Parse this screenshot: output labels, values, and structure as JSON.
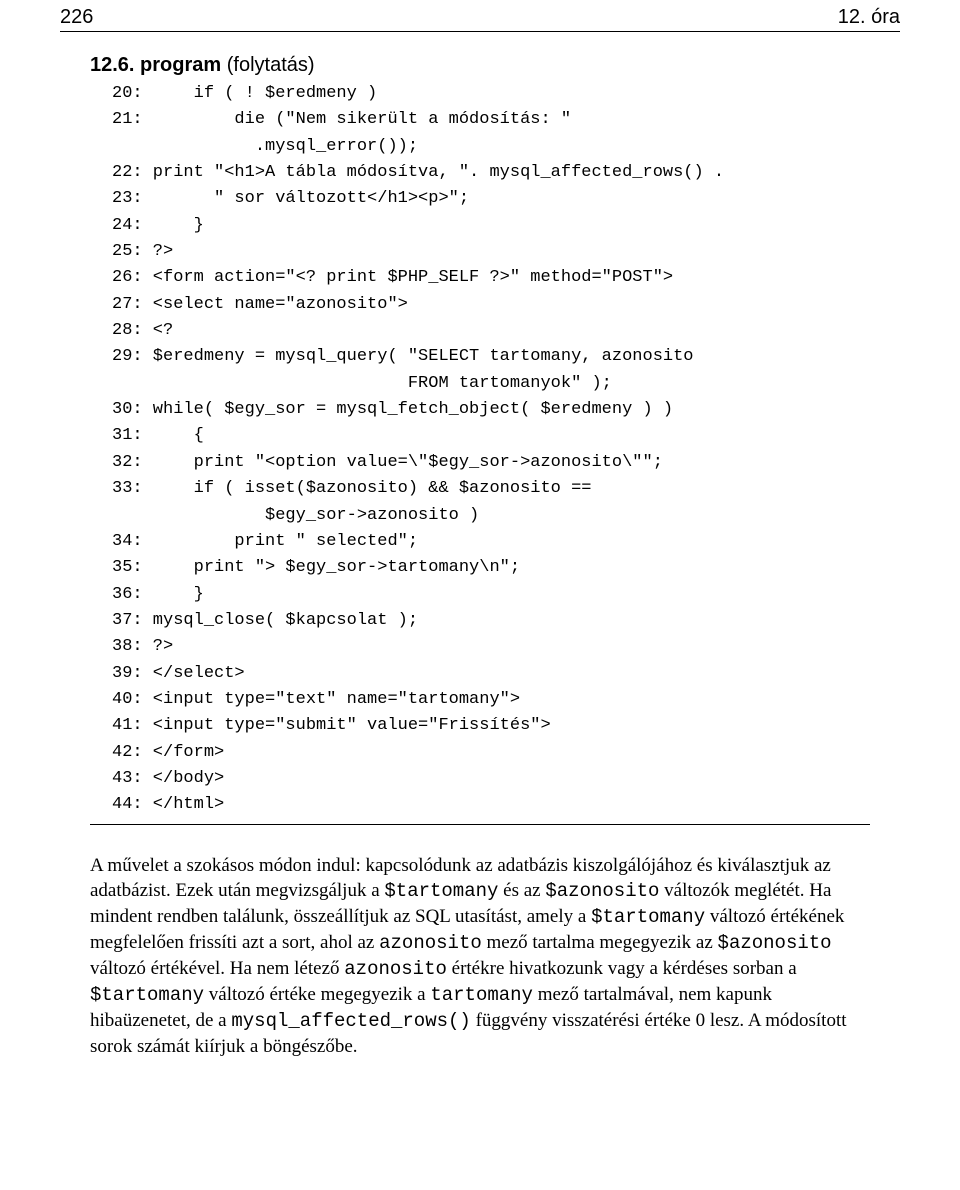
{
  "header": {
    "page_number": "226",
    "chapter": "12. óra"
  },
  "program": {
    "number": "12.6.",
    "label": "program",
    "suffix": "(folytatás)"
  },
  "code": "20:     if ( ! $eredmeny )\n21:         die (\"Nem sikerült a módosítás: \"\n              .mysql_error());\n22: print \"<h1>A tábla módosítva, \". mysql_affected_rows() .\n23:       \" sor változott</h1><p>\";\n24:     }\n25: ?>\n26: <form action=\"<? print $PHP_SELF ?>\" method=\"POST\">\n27: <select name=\"azonosito\">\n28: <?\n29: $eredmeny = mysql_query( \"SELECT tartomany, azonosito\n                             FROM tartomanyok\" );\n30: while( $egy_sor = mysql_fetch_object( $eredmeny ) )\n31:     {\n32:     print \"<option value=\\\"$egy_sor->azonosito\\\"\";\n33:     if ( isset($azonosito) && $azonosito ==\n               $egy_sor->azonosito )\n34:         print \" selected\";\n35:     print \"> $egy_sor->tartomany\\n\";\n36:     }\n37: mysql_close( $kapcsolat );\n38: ?>\n39: </select>\n40: <input type=\"text\" name=\"tartomany\">\n41: <input type=\"submit\" value=\"Frissítés\">\n42: </form>\n43: </body>\n44: </html>",
  "paragraph": {
    "p1": "A művelet a szokásos módon indul: kapcsolódunk az adatbázis kiszolgálójához és kiválasztjuk az adatbázist. Ezek után megvizsgáljuk a ",
    "tartomany1": "$tartomany",
    "p2": " és az ",
    "azonosito1": "$azonosito",
    "p3": " változók meglétét. Ha mindent rendben találunk, összeállítjuk az SQL utasítást, amely a ",
    "tartomany2": "$tartomany",
    "p4": " változó értékének megfelelően frissíti azt a sort, ahol az ",
    "azonosito2": "azonosito",
    "p5": " mező tartalma megegyezik az ",
    "azonosito3": "$azonosito",
    "p6": " változó értékével. Ha nem létező ",
    "azonosito4": "azonosito",
    "p7": " értékre hivatkozunk vagy a kérdéses sorban a ",
    "tartomany3": "$tartomany",
    "p8": " változó értéke megegyezik a ",
    "tartomany4": "tartomany",
    "p9": " mező tartalmával, nem kapunk hibaüzenetet, de a ",
    "func": "mysql_affected_rows()",
    "p10": " függvény visszatérési értéke 0 lesz. A módosított sorok számát kiírjuk a böngészőbe."
  }
}
